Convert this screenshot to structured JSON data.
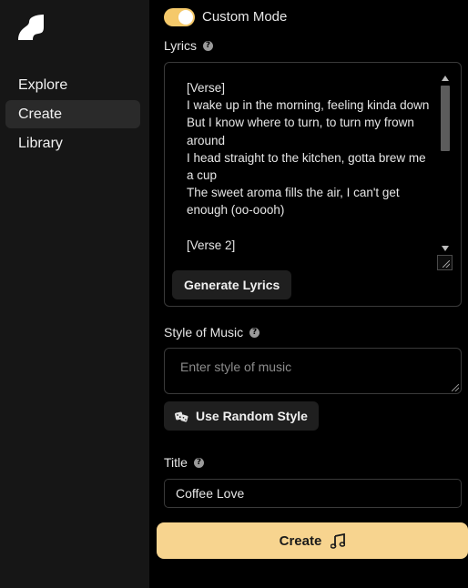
{
  "sidebar": {
    "logo_icon": "wave-logo-icon",
    "items": [
      {
        "label": "Explore",
        "active": false
      },
      {
        "label": "Create",
        "active": true
      },
      {
        "label": "Library",
        "active": false
      }
    ]
  },
  "custom_mode": {
    "label": "Custom Mode",
    "enabled": true
  },
  "lyrics": {
    "label": "Lyrics",
    "help_icon": "help-icon",
    "value": "[Verse]\nI wake up in the morning, feeling kinda down\nBut I know where to turn, to turn my frown around\nI head straight to the kitchen, gotta brew me a cup\nThe sweet aroma fills the air, I can't get enough (oo-oooh)\n\n[Verse 2]",
    "generate_button": "Generate Lyrics"
  },
  "style": {
    "label": "Style of Music",
    "help_icon": "help-icon",
    "placeholder": "Enter style of music",
    "random_button": "Use Random Style",
    "random_icon": "dice-icon"
  },
  "title": {
    "label": "Title",
    "help_icon": "help-icon",
    "value": "Coffee Love"
  },
  "create": {
    "label": "Create",
    "icon": "music-note-icon"
  },
  "colors": {
    "accent": "#f7d48f",
    "toggle": "#f5c96a",
    "sidebar_bg": "#161616"
  }
}
